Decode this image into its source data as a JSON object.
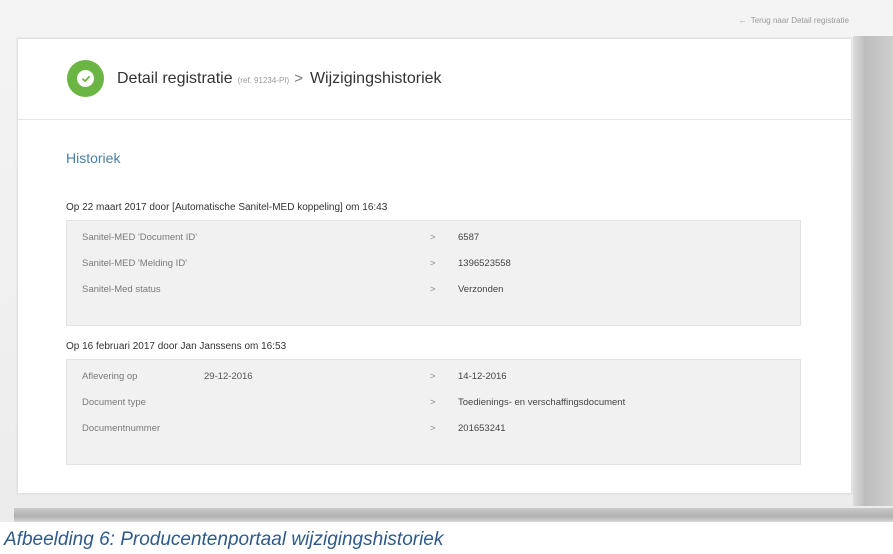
{
  "header": {
    "back_link": "Terug naar Detail registratie",
    "title": "Detail registratie",
    "ref": "(ref. 91234-PI)",
    "separator": ">",
    "subtitle": "Wijzigingshistoriek"
  },
  "section": {
    "title": "Historiek"
  },
  "entries": [
    {
      "heading": "Op 22 maart 2017 door [Automatische Sanitel-MED koppeling] om 16:43",
      "rows": [
        {
          "label": "Sanitel-MED 'Document ID'",
          "old": "",
          "arrow": ">",
          "new": "6587"
        },
        {
          "label": "Sanitel-MED 'Melding ID'",
          "old": "",
          "arrow": ">",
          "new": "1396523558"
        },
        {
          "label": "Sanitel-Med status",
          "old": "",
          "arrow": ">",
          "new": "Verzonden"
        }
      ]
    },
    {
      "heading": "Op 16 februari 2017 door Jan Janssens om 16:53",
      "rows": [
        {
          "label": "Aflevering op",
          "old": "29-12-2016",
          "arrow": ">",
          "new": "14-12-2016"
        },
        {
          "label": "Document type",
          "old": "",
          "arrow": ">",
          "new": "Toedienings- en verschaffingsdocument"
        },
        {
          "label": "Documentnummer",
          "old": "",
          "arrow": ">",
          "new": "201653241"
        }
      ]
    }
  ],
  "caption": "Afbeelding 6: Producentenportaal wijzigingshistoriek",
  "colors": {
    "success": "#6ab544",
    "section_title": "#4a7fa6",
    "caption": "#2e5a8c",
    "table_bg": "#f1f1f1"
  },
  "icons": {
    "status": "check-circle-icon",
    "back": "arrow-left-icon"
  }
}
